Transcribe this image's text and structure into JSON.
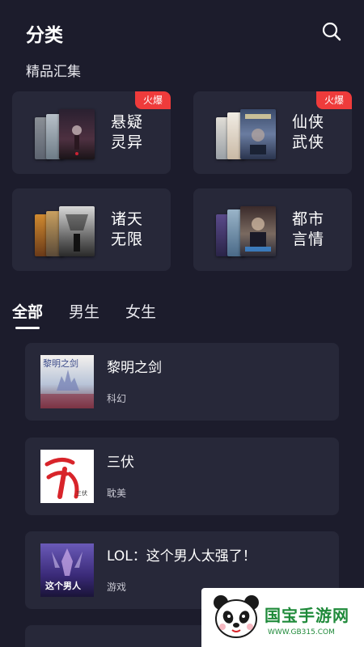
{
  "header": {
    "title": "分类",
    "search_icon": "search-icon"
  },
  "collections": {
    "title": "精品汇集",
    "items": [
      {
        "name_line1": "悬疑",
        "name_line2": "灵异",
        "badge": "火爆"
      },
      {
        "name_line1": "仙侠",
        "name_line2": "武侠",
        "badge": "火爆"
      },
      {
        "name_line1": "诸天",
        "name_line2": "无限",
        "badge": ""
      },
      {
        "name_line1": "都市",
        "name_line2": "言情",
        "badge": ""
      }
    ]
  },
  "tabs": [
    {
      "label": "全部",
      "active": true
    },
    {
      "label": "男生",
      "active": false
    },
    {
      "label": "女生",
      "active": false
    }
  ],
  "books": [
    {
      "title": "黎明之剑",
      "genre": "科幻",
      "cover_text": "黎明之剑"
    },
    {
      "title": "三伏",
      "genre": "耽美",
      "cover_text": "三伏"
    },
    {
      "title": "LOL：这个男人太强了！",
      "genre": "游戏",
      "cover_text": "这个男人"
    }
  ],
  "watermark": {
    "text": "国宝手游网",
    "url": "WWW.GB315.COM"
  },
  "colors": {
    "background": "#1c1c2c",
    "card": "#272839",
    "badge": "#ef3b3b",
    "watermark_green": "#1f8a3a"
  }
}
